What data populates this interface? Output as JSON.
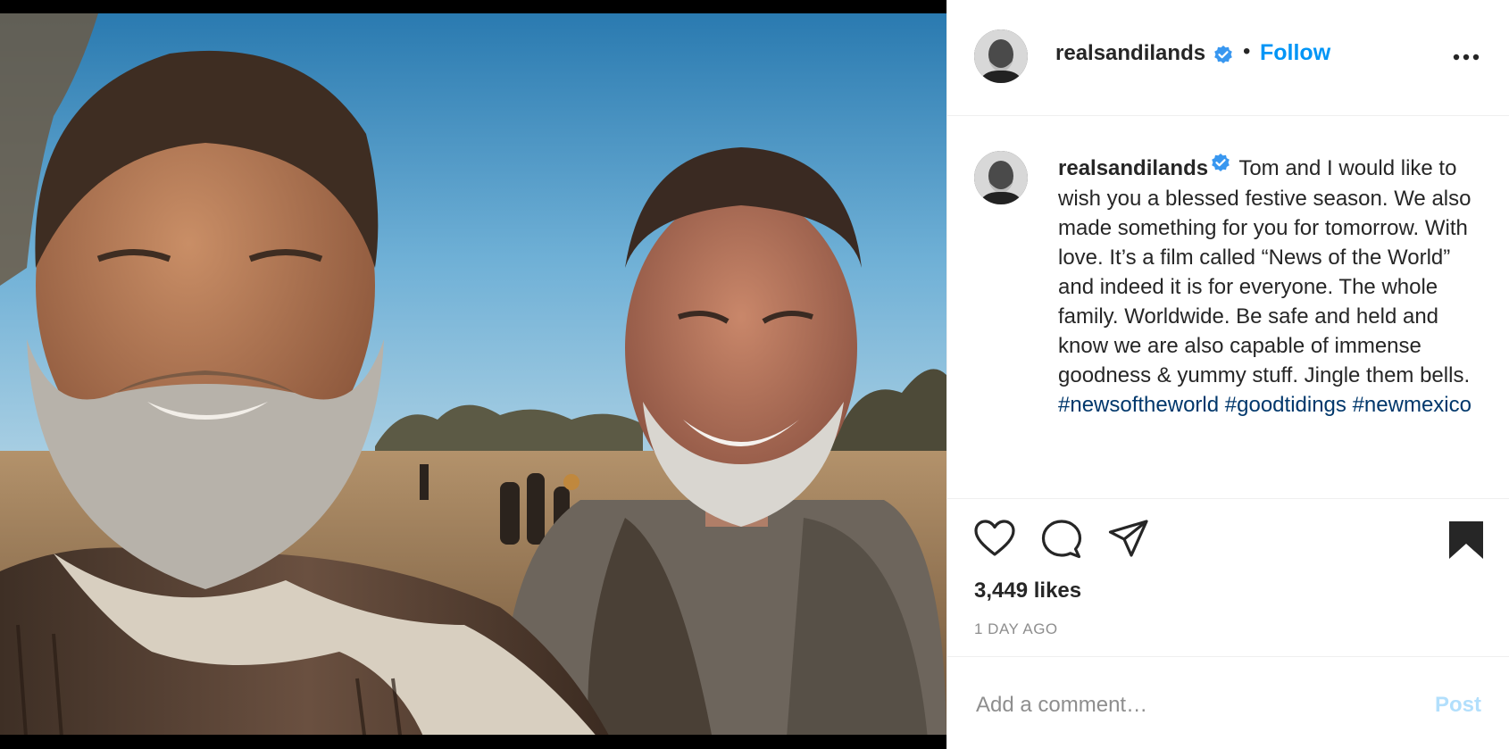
{
  "post": {
    "username": "realsandilands",
    "separator": "•",
    "follow_label": "Follow",
    "caption": {
      "body": "Tom and I would like to wish you a blessed festive season. We also made something for you for tomorrow. With love. It’s a film called “News of the World” and indeed it is for everyone. The whole family. Worldwide. Be safe and held and know we are also capable of immense goodness & yummy stuff. Jingle them bells. ",
      "hashtags": [
        "#newsoftheworld",
        "#goodtidings",
        "#newmexico"
      ]
    },
    "likes": "3,449 likes",
    "timestamp": "1 DAY AGO"
  },
  "comment": {
    "placeholder": "Add a comment…",
    "post_label": "Post"
  },
  "icons": {
    "verified": "verified-badge-icon",
    "more": "more-options-icon",
    "like": "heart-icon",
    "comment": "comment-bubble-icon",
    "share": "paper-plane-icon",
    "save": "bookmark-filled-icon"
  },
  "colors": {
    "accent": "#0095f6",
    "verified": "#3897f0",
    "hashtag": "#00376b",
    "post_disabled": "#b2dffc",
    "muted": "#8e8e8e"
  }
}
